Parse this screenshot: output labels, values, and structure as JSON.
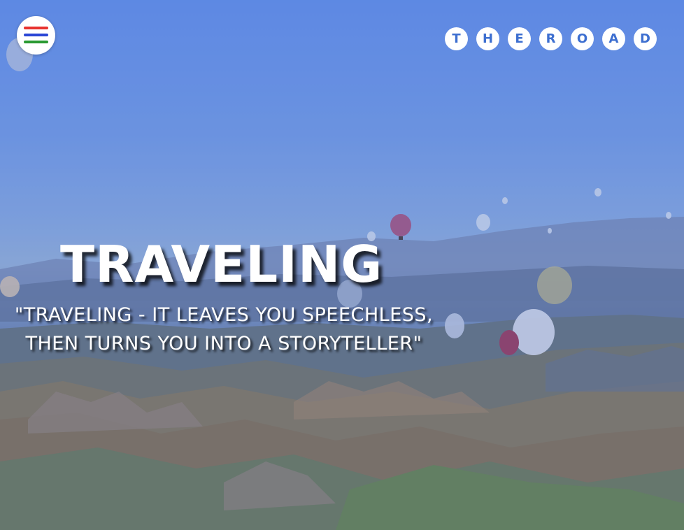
{
  "header": {
    "menu_icon": "hamburger-menu-icon",
    "menu_colors": [
      "#e8332f",
      "#2b47d6",
      "#2a9a32"
    ],
    "brand_letters": [
      "T",
      "H",
      "E",
      "R",
      "O",
      "A",
      "D"
    ]
  },
  "hero": {
    "title": "TRAVELING",
    "quote_line1": "\"TRAVELING - IT LEAVES YOU SPEECHLESS,",
    "quote_line2": "THEN TURNS YOU INTO A STORYTELLER\"",
    "background_image": "hot-air-balloons-over-valley-photo"
  },
  "colors": {
    "accent": "#3d6fd0",
    "text": "#ffffff"
  }
}
